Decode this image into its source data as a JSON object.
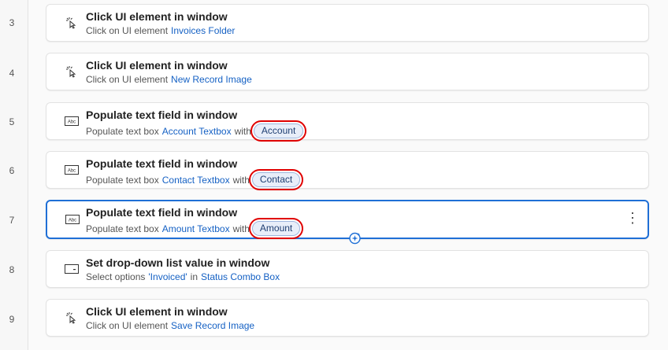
{
  "steps": [
    {
      "number": "3",
      "icon": "click-cursor-icon",
      "title": "Click UI element in window",
      "prefix": "Click on UI element",
      "target": "Invoices Folder"
    },
    {
      "number": "4",
      "icon": "click-cursor-icon",
      "title": "Click UI element in window",
      "prefix": "Click on UI element",
      "target": "New Record Image"
    },
    {
      "number": "5",
      "icon": "textbox-icon",
      "title": "Populate text field in window",
      "prefix": "Populate text box",
      "target": "Account Textbox",
      "joiner": "with",
      "variable": "Account"
    },
    {
      "number": "6",
      "icon": "textbox-icon",
      "title": "Populate text field in window",
      "prefix": "Populate text box",
      "target": "Contact Textbox",
      "joiner": "with",
      "variable": "Contact"
    },
    {
      "number": "7",
      "icon": "textbox-icon",
      "title": "Populate text field in window",
      "prefix": "Populate text box",
      "target": "Amount Textbox",
      "joiner": "with",
      "variable": "Amount"
    },
    {
      "number": "8",
      "icon": "dropdown-icon",
      "title": "Set drop-down list value in window",
      "prefix": "Select options",
      "value": "'Invoiced'",
      "joiner": "in",
      "target": "Status Combo Box"
    },
    {
      "number": "9",
      "icon": "click-cursor-icon",
      "title": "Click UI element in window",
      "prefix": "Click on UI element",
      "target": "Save Record Image"
    }
  ],
  "icons": {
    "more": "⋮",
    "textbox_label": "Abc"
  },
  "colors": {
    "link": "#1561c4",
    "selected_border": "#1f6fd6",
    "highlight": "#e00000"
  }
}
